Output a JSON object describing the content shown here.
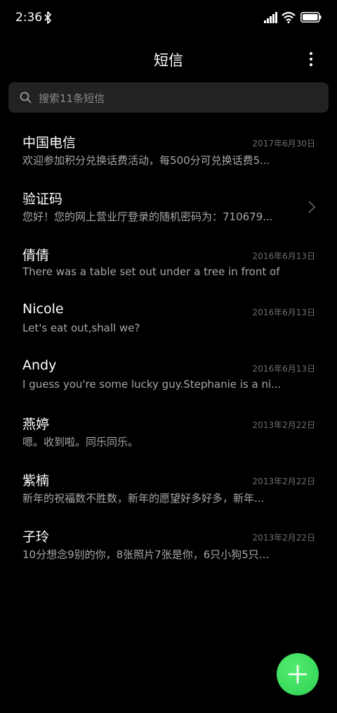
{
  "status_bar": {
    "time": "2:36",
    "icons": [
      "bluetooth-icon",
      "signal-icon",
      "wifi-icon",
      "battery-icon"
    ]
  },
  "header": {
    "title": "短信",
    "more_icon": "more-vertical-icon"
  },
  "search": {
    "placeholder": "搜索11条短信",
    "icon": "search-icon"
  },
  "conversations": [
    {
      "name": "中国电信",
      "date": "2017年6月30日",
      "preview": "欢迎参加积分兑换话费活动，每500分可兑换话费5..."
    },
    {
      "name": "验证码",
      "date": "",
      "preview": "您好！您的网上营业厅登录的随机密码为：710679..."
    },
    {
      "name": "倩倩",
      "date": "2016年6月13日",
      "preview": "There was a table set out under a tree in front of ..."
    },
    {
      "name": "Nicole",
      "date": "2016年6月13日",
      "preview": "Let's eat out,shall we?"
    },
    {
      "name": "Andy",
      "date": "2016年6月13日",
      "preview": "I guess you're some lucky guy.Stephanie is a ni..."
    },
    {
      "name": "燕婷",
      "date": "2013年2月22日",
      "preview": "嗯。收到啦。同乐同乐。"
    },
    {
      "name": "紫楠",
      "date": "2013年2月22日",
      "preview": "新年的祝福数不胜数，新年的愿望好多好多，新年..."
    },
    {
      "name": "子玲",
      "date": "2013年2月22日",
      "preview": "10分想念9别的你，8张照片7张是你，6只小狗5只..."
    }
  ],
  "fab": {
    "icon": "plus-icon",
    "color": "#3ddc5f"
  },
  "colors": {
    "background": "#000000",
    "search_background": "#222222",
    "accent": "#3ddc5f"
  }
}
